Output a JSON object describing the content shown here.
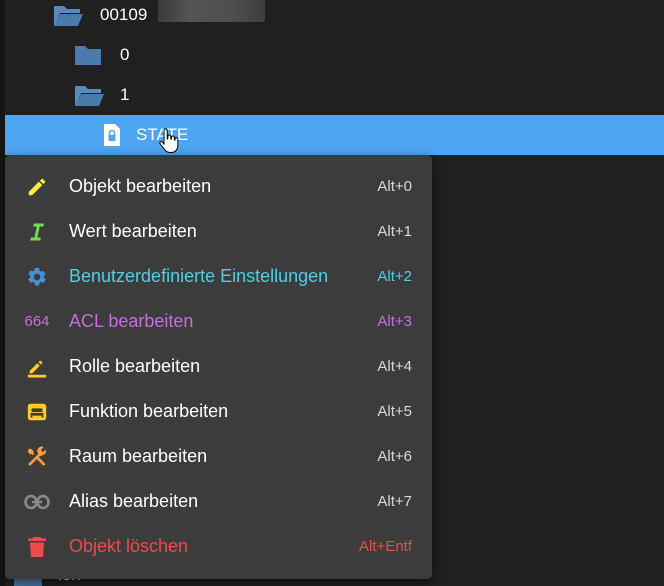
{
  "tree": {
    "rows": [
      {
        "label": "00109",
        "icon": "folder-open-icon"
      },
      {
        "label": "0",
        "icon": "folder-icon"
      },
      {
        "label": "1",
        "icon": "folder-open-icon"
      },
      {
        "label": "STATE",
        "icon": "locked-file-icon",
        "selected": true
      }
    ],
    "partial_label": "len"
  },
  "context_menu": {
    "items": [
      {
        "label": "Objekt bearbeiten",
        "shortcut": "Alt+0",
        "icon": "pencil-icon",
        "color": "#ffffff",
        "icon_color": "#ffeb3b"
      },
      {
        "label": "Wert bearbeiten",
        "shortcut": "Alt+1",
        "icon": "text-cursor-icon",
        "color": "#ffffff",
        "icon_color": "#6fe04a"
      },
      {
        "label": "Benutzerdefinierte Einstellungen",
        "shortcut": "Alt+2",
        "icon": "gear-icon",
        "color": "#4dd0e1",
        "icon_color": "#4a8fd0"
      },
      {
        "label": "ACL bearbeiten",
        "shortcut": "Alt+3",
        "icon": "acl-664-icon",
        "icon_text": "664",
        "color": "#c86ee0",
        "icon_color": "#c86ee0"
      },
      {
        "label": "Rolle bearbeiten",
        "shortcut": "Alt+4",
        "icon": "edit-underline-icon",
        "color": "#ffffff",
        "icon_color": "#ffca28"
      },
      {
        "label": "Funktion bearbeiten",
        "shortcut": "Alt+5",
        "icon": "function-icon",
        "color": "#ffffff",
        "icon_color": "#ffca28"
      },
      {
        "label": "Raum bearbeiten",
        "shortcut": "Alt+6",
        "icon": "tools-icon",
        "color": "#ffffff",
        "icon_color": "#ff9f3a"
      },
      {
        "label": "Alias bearbeiten",
        "shortcut": "Alt+7",
        "icon": "link-icon",
        "color": "#ffffff",
        "icon_color": "#8a8a8a"
      },
      {
        "label": "Objekt löschen",
        "shortcut": "Alt+Entf",
        "icon": "trash-icon",
        "color": "#ef4b4b",
        "icon_color": "#ef4b4b"
      }
    ]
  }
}
